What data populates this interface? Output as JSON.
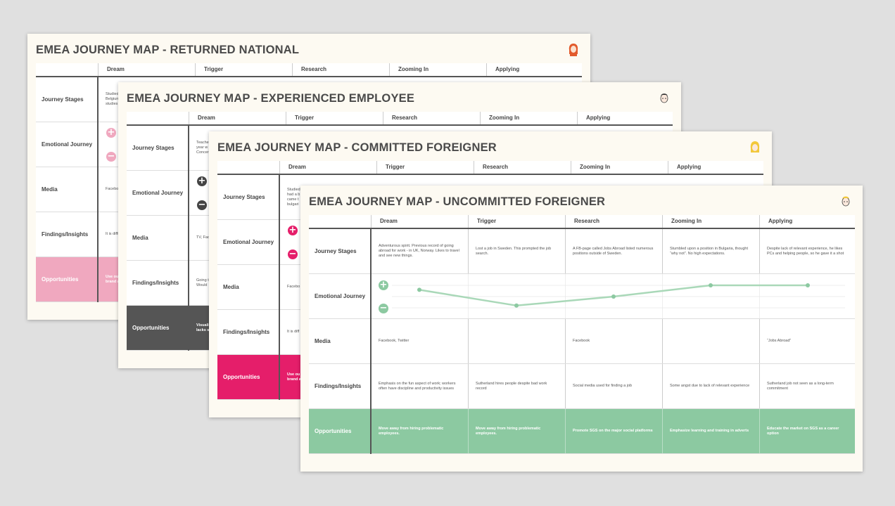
{
  "columns": [
    "Dream",
    "Trigger",
    "Research",
    "Zooming In",
    "Applying"
  ],
  "row_labels": [
    "Journey Stages",
    "Emotional Journey",
    "Media",
    "Findings/Insights",
    "Opportunities"
  ],
  "emotion_symbols": {
    "positive": "+",
    "negative": "−"
  },
  "cards": [
    {
      "id": "returned-national",
      "title": "EMEA JOURNEY MAP - RETURNED NATIONAL",
      "accent": "#f0a8bf",
      "visible_text": {
        "journey": [
          "Studied",
          "Belgium",
          "studies"
        ],
        "media": "Facebo",
        "findings": "It is diffi",
        "opportunities": [
          "Use ou",
          "brand a"
        ]
      }
    },
    {
      "id": "experienced-employee",
      "title": "EMEA JOURNEY MAP - EXPERIENCED EMPLOYEE",
      "accent": "#555555",
      "visible_text": {
        "journey": [
          "Teache",
          "year w",
          "Concer"
        ],
        "media": "TV, Fac",
        "findings": [
          "Going t",
          "Would"
        ],
        "opportunities": [
          "Visuali",
          "lacks s"
        ]
      }
    },
    {
      "id": "committed-foreigner",
      "title": "EMEA JOURNEY MAP - COMMITTED FOREIGNER",
      "accent": "#e51e6a",
      "visible_text": {
        "journey": [
          "Studied",
          "had a b",
          "came t",
          "bulgari"
        ],
        "media": "Facebo",
        "findings": "It is diff",
        "opportunities": [
          "Use ou",
          "brand a"
        ]
      }
    },
    {
      "id": "uncommitted-foreigner",
      "title": "EMEA JOURNEY MAP - UNCOMMITTED FOREIGNER",
      "accent": "#8cc9a1",
      "line_color": "#a9d8b8",
      "journey_stages": [
        "Adventurous spirit. Previous record of going abroad for work - in UK, Norway. Likes to travel and see new things.",
        "Lost a job in Sweden. This prompted the job search.",
        "A FB-page called Jobs Abroad listed numerous positions outside of Sweden.",
        "Stumbled upon a position in Bulgaria, thought “why not”. No high expectations.",
        "Despite lack of relevant experience, he likes PCs and helping people, so he gave it a shot"
      ],
      "emotion_levels": [
        0.8,
        0.1,
        0.5,
        1.0,
        1.0
      ],
      "media": [
        "Facebook, Twitter",
        "",
        "Facebook",
        "",
        "“Jobs Abroad”"
      ],
      "findings": [
        "Emphasis on the fun aspect of work; workers often have discipline and productivity issues",
        "Sutherland hires people despite bad work record",
        "Social media used for finding a job",
        "Some angst due to lack of relevant experience",
        "Sutherland job not seen as a long-term commitment"
      ],
      "opportunities": [
        "Move away from hiring problematic employees.",
        "Move away from hiring problematic employees.",
        "Promote SGS on the major social platforms",
        "Emphasize learning and training in adverts",
        "Educate the market on SGS as a career option"
      ]
    }
  ]
}
